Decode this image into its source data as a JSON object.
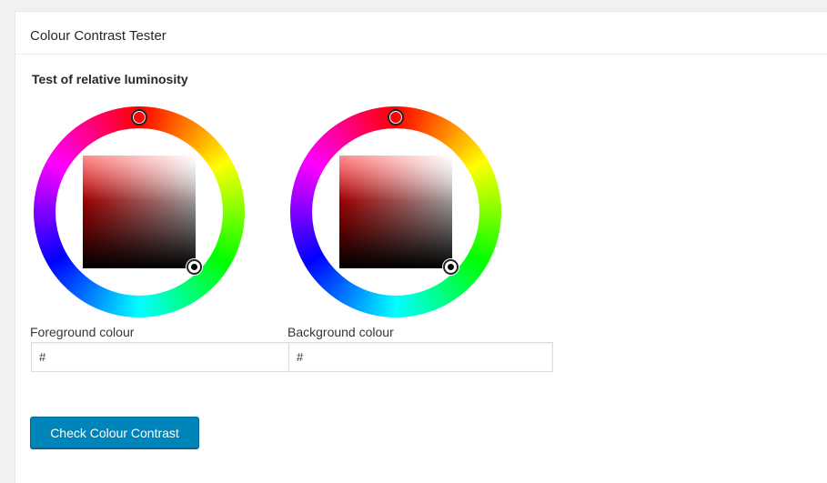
{
  "panel": {
    "title": "Colour Contrast Tester",
    "section_heading": "Test of relative luminosity"
  },
  "foreground": {
    "label": "Foreground colour",
    "value": "#"
  },
  "background": {
    "label": "Background colour",
    "value": "#"
  },
  "actions": {
    "check_label": "Check Colour Contrast"
  },
  "colors": {
    "accent": "#0085ba",
    "selected_hue": "#ff0000"
  }
}
